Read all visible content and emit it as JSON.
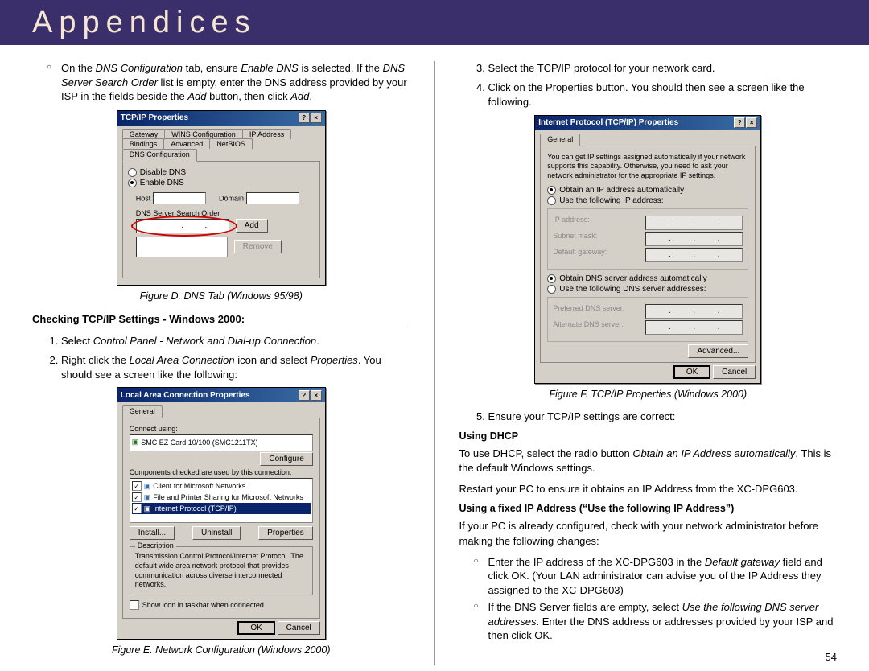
{
  "header": {
    "title": "Appendices"
  },
  "page_number": "54",
  "left": {
    "bullet1": "On the DNS Configuration tab, ensure Enable DNS is selected. If the DNS Server Search Order list is empty, enter the DNS address provided by your ISP in the fields beside the Add button, then click Add.",
    "figD": {
      "title": "TCP/IP Properties",
      "tabs_row1": [
        "Gateway",
        "WINS Configuration",
        "IP Address"
      ],
      "tabs_row2": [
        "Bindings",
        "Advanced",
        "NetBIOS",
        "DNS Configuration"
      ],
      "radio_disable": "Disable DNS",
      "radio_enable": "Enable DNS",
      "host_label": "Host",
      "domain_label": "Domain",
      "search_label": "DNS Server Search Order",
      "add_btn": "Add",
      "remove_btn": "Remove",
      "caption": "Figure D. DNS Tab (Windows 95/98)"
    },
    "section_head": "Checking TCP/IP Settings - Windows 2000:",
    "step1": "Select Control Panel - Network and Dial-up Connection.",
    "step2": "Right click the Local Area Connection icon and select Properties. You should see a screen like the following:",
    "figE": {
      "title": "Local Area Connection Properties",
      "tab_general": "General",
      "connect_label": "Connect using:",
      "adapter": "SMC EZ Card 10/100 (SMC1211TX)",
      "configure_btn": "Configure",
      "components_label": "Components checked are used by this connection:",
      "comp1": "Client for Microsoft Networks",
      "comp2": "File and Printer Sharing for Microsoft Networks",
      "comp3": "Internet Protocol (TCP/IP)",
      "install_btn": "Install...",
      "uninstall_btn": "Uninstall",
      "properties_btn": "Properties",
      "desc_label": "Description",
      "desc_text": "Transmission Control Protocol/Internet Protocol. The default wide area network protocol that provides communication across diverse interconnected networks.",
      "show_icon": "Show icon in taskbar when connected",
      "ok_btn": "OK",
      "cancel_btn": "Cancel",
      "caption": "Figure E. Network Configuration (Windows 2000)"
    }
  },
  "right": {
    "step3": "Select the TCP/IP protocol for your network card.",
    "step4": "Click on the Properties button. You should then see a screen like the following.",
    "figF": {
      "title": "Internet Protocol (TCP/IP) Properties",
      "tab_general": "General",
      "intro": "You can get IP settings assigned automatically if your network supports this capability. Otherwise, you need to ask your network administrator for the appropriate IP settings.",
      "r_auto_ip": "Obtain an IP address automatically",
      "r_use_ip": "Use the following IP address:",
      "l_ipaddr": "IP address:",
      "l_subnet": "Subnet mask:",
      "l_gateway": "Default gateway:",
      "r_auto_dns": "Obtain DNS server address automatically",
      "r_use_dns": "Use the following DNS server addresses:",
      "l_pref_dns": "Preferred DNS server:",
      "l_alt_dns": "Alternate DNS server:",
      "advanced_btn": "Advanced...",
      "ok_btn": "OK",
      "cancel_btn": "Cancel",
      "caption": "Figure F. TCP/IP Properties (Windows 2000)"
    },
    "step5": "Ensure your TCP/IP settings are correct:",
    "sub_dhcp": "Using DHCP",
    "dhcp_p1": "To use DHCP, select the radio button Obtain an IP Address automatically. This is the default Windows settings.",
    "dhcp_p2": "Restart your PC to ensure it obtains an IP Address from the XC-DPG603.",
    "sub_fixed": "Using a fixed IP Address (“Use the following IP Address”)",
    "fixed_intro": "If your PC is already configured, check with your network administrator before making the following changes:",
    "fixed_b1": "Enter the IP address of the XC-DPG603 in the Default gateway field and click OK. (Your LAN administrator can advise you of the IP Address they assigned to the XC-DPG603)",
    "fixed_b2": "If the DNS Server fields are empty, select Use the following DNS server addresses. Enter the DNS address or addresses provided by your ISP and then click OK."
  }
}
